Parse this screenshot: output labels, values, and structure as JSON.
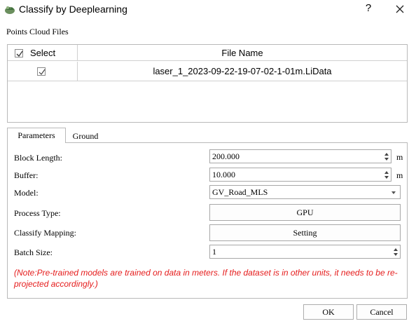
{
  "window": {
    "title": "Classify by Deeplearning",
    "help_label": "?",
    "icons": {
      "app": "app-icon",
      "close": "close-icon"
    }
  },
  "files_section": {
    "label": "Points Cloud Files",
    "columns": [
      "Select",
      "File Name"
    ],
    "header_checked": true,
    "rows": [
      {
        "selected": true,
        "file_name": "laser_1_2023-09-22-19-07-02-1-01m.LiData"
      }
    ]
  },
  "tabs": [
    {
      "label": "Parameters",
      "active": true
    },
    {
      "label": "Ground",
      "active": false
    }
  ],
  "parameters": {
    "block_length": {
      "label": "Block Length:",
      "value": "200.000",
      "unit": "m"
    },
    "buffer": {
      "label": "Buffer:",
      "value": "10.000",
      "unit": "m"
    },
    "model": {
      "label": "Model:",
      "value": "GV_Road_MLS"
    },
    "process_type": {
      "label": "Process Type:",
      "button": "GPU"
    },
    "classify_mapping": {
      "label": "Classify Mapping:",
      "button": "Setting"
    },
    "batch_size": {
      "label": "Batch Size:",
      "value": "1"
    },
    "note": "(Note:Pre-trained models are trained on data in meters. If the dataset is in other units, it needs to be re-projected accordingly.)"
  },
  "buttons": {
    "ok": "OK",
    "cancel": "Cancel"
  },
  "colors": {
    "note_text": "#e51c1c",
    "border": "#b9b9b9"
  }
}
